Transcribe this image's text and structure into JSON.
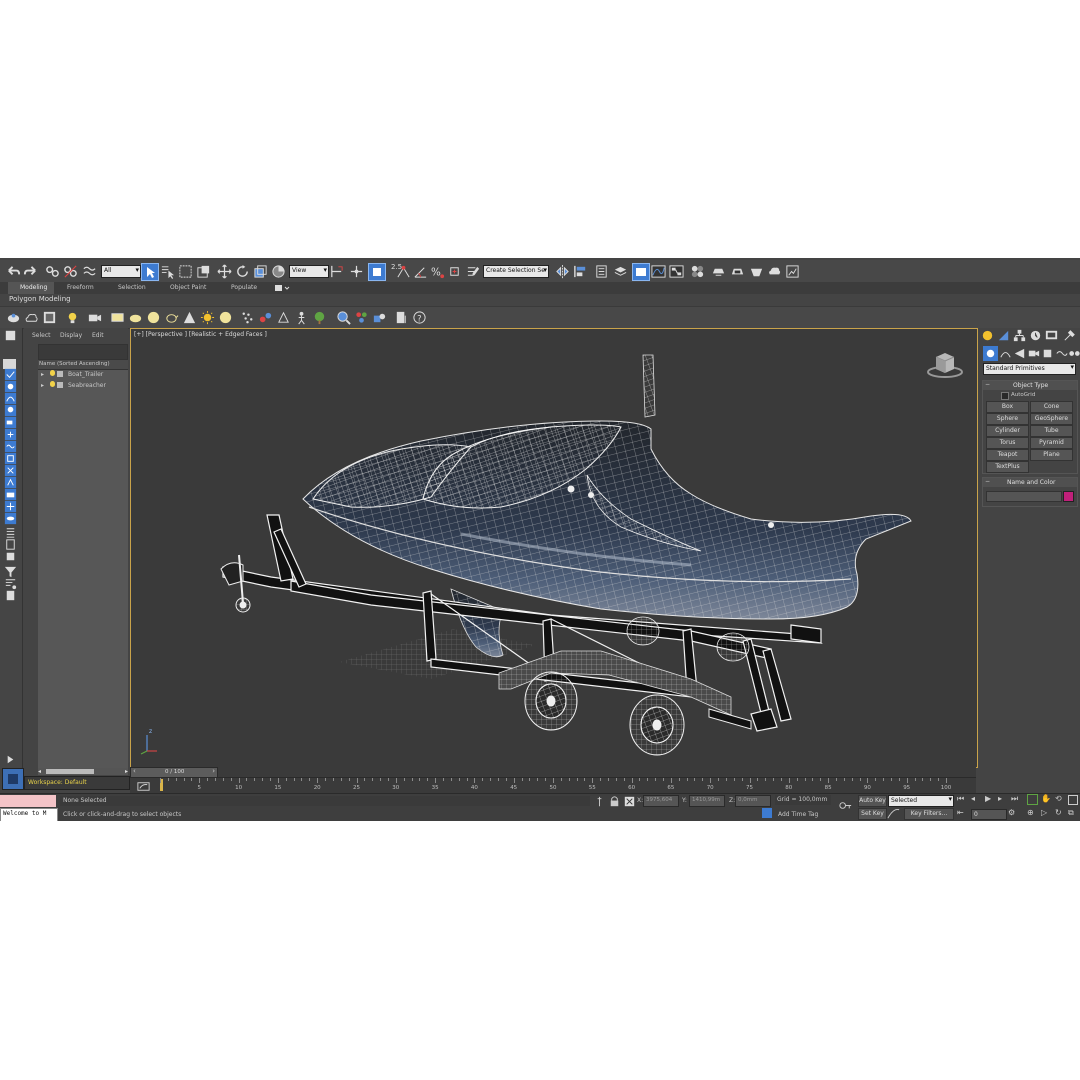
{
  "toolbar": {
    "filter_dropdown": "All",
    "ref_coord_dropdown": "View",
    "snap_2_5": "2.5",
    "selection_set_field": "Create Selection Se"
  },
  "ribbon": {
    "tabs": [
      "Modeling",
      "Freeform",
      "Selection",
      "Object Paint",
      "Populate"
    ],
    "subtitle": "Polygon Modeling"
  },
  "scene_explorer": {
    "menu": [
      "Select",
      "Display",
      "Edit"
    ],
    "column_header": "Name (Sorted Ascending)",
    "items": [
      "Boat_Trailer",
      "Seabreacher"
    ],
    "workspace": "Workspace: Default"
  },
  "viewport": {
    "label": "[+] [Perspective ] [Realistic + Edged Faces ]",
    "axis_label": "z"
  },
  "command_panel": {
    "category_dropdown": "Standard Primitives",
    "object_type_title": "Object Type",
    "autogrid_label": "AutoGrid",
    "primitives": [
      "Box",
      "Cone",
      "Sphere",
      "GeoSphere",
      "Cylinder",
      "Tube",
      "Torus",
      "Pyramid",
      "Teapot",
      "Plane",
      "TextPlus"
    ],
    "name_color_title": "Name and Color",
    "color_swatch": "#c0207a"
  },
  "timeline": {
    "frame_indicator": "0 / 100",
    "ticks": [
      "5",
      "10",
      "15",
      "20",
      "25",
      "30",
      "35",
      "40",
      "45",
      "50",
      "55",
      "60",
      "65",
      "70",
      "75",
      "80",
      "85",
      "90",
      "95",
      "100"
    ]
  },
  "status": {
    "maxscript_line": "Welcome to M",
    "selection_status": "None Selected",
    "prompt": "Click or click-and-drag to select objects",
    "x_label": "X:",
    "x_value": "3975,604",
    "y_label": "Y:",
    "y_value": "1410,99m",
    "z_label": "Z:",
    "z_value": "0,0mm",
    "grid": "Grid = 100,0mm",
    "add_time_tag": "Add Time Tag",
    "auto_key": "Auto Key",
    "set_key": "Set Key",
    "key_dropdown": "Selected",
    "key_filters": "Key Filters...",
    "frame_field": "0"
  },
  "colors": {
    "ui_bg": "#444444",
    "viewport_bg": "#3a3a3a",
    "active_border": "#c9a34a",
    "accent_blue": "#3d7bd1"
  }
}
